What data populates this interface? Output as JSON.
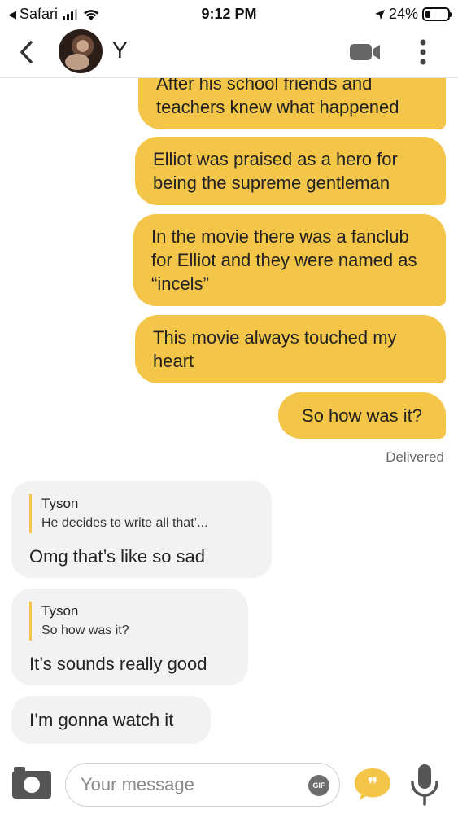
{
  "status_bar": {
    "back_app": "Safari",
    "time": "9:12 PM",
    "battery_percent": "24%",
    "battery_level": 0.24,
    "signal_bars": 3
  },
  "header": {
    "contact_name": "Y",
    "icons": [
      "chevron-left-icon",
      "avatar",
      "video-call-icon",
      "more-vertical-icon"
    ]
  },
  "messages": {
    "sent_1": "After his school friends and teachers knew what happened",
    "sent_2": "Elliot was praised as a hero for being the supreme gentleman",
    "sent_3": "In the movie there was a fanclub for Elliot and they were named as “incels”",
    "sent_4": "This movie always touched my heart",
    "sent_5": "So how was it?",
    "delivered": "Delivered",
    "recv_1": {
      "quote_name": "Tyson",
      "quote_text": "He decides to write all that’...",
      "text": "Omg that’s like so sad"
    },
    "recv_2": {
      "quote_name": "Tyson",
      "quote_text": "So how was it?",
      "text": "It’s sounds really good"
    },
    "recv_3": "I’m gonna watch it"
  },
  "composer": {
    "placeholder": "Your message",
    "gif_label": "GIF",
    "accent_color": "#f3c548"
  }
}
